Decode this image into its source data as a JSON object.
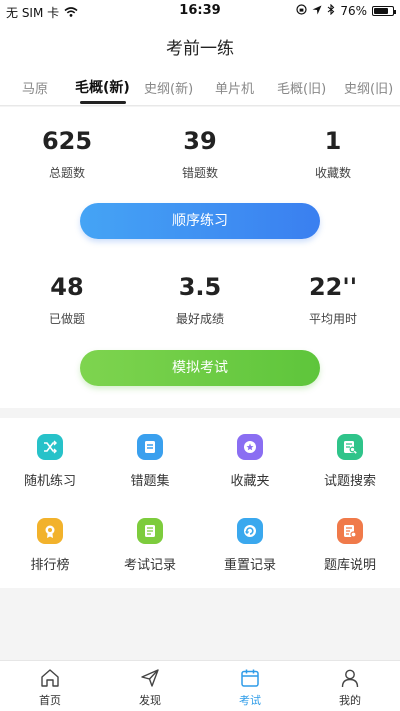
{
  "status_bar": {
    "carrier": "无 SIM 卡",
    "time": "16:39",
    "battery": "76%",
    "battery_level": 0.76
  },
  "nav": {
    "title": "考前一练"
  },
  "tabs": [
    {
      "label": "马原",
      "active": false
    },
    {
      "label": "毛概(新)",
      "active": true
    },
    {
      "label": "史纲(新)",
      "active": false
    },
    {
      "label": "单片机",
      "active": false
    },
    {
      "label": "毛概(旧)",
      "active": false
    },
    {
      "label": "史纲(旧)",
      "active": false
    }
  ],
  "stats_top": [
    {
      "value": "625",
      "label": "总题数"
    },
    {
      "value": "39",
      "label": "错题数"
    },
    {
      "value": "1",
      "label": "收藏数"
    }
  ],
  "practice_button": "顺序练习",
  "stats_bottom": [
    {
      "value": "48",
      "label": "已做题"
    },
    {
      "value": "3.5",
      "label": "最好成绩"
    },
    {
      "value": "22''",
      "label": "平均用时"
    }
  ],
  "exam_button": "模拟考试",
  "features": [
    {
      "label": "随机练习",
      "icon": "shuffle-icon",
      "color": "#27c2c9"
    },
    {
      "label": "错题集",
      "icon": "note-icon",
      "color": "#3aa0ee"
    },
    {
      "label": "收藏夹",
      "icon": "star-icon",
      "color": "#8a6ef2"
    },
    {
      "label": "试题搜索",
      "icon": "search-doc-icon",
      "color": "#2fc48a"
    },
    {
      "label": "排行榜",
      "icon": "trophy-icon",
      "color": "#f2b22c"
    },
    {
      "label": "考试记录",
      "icon": "list-icon",
      "color": "#7dcc3d"
    },
    {
      "label": "重置记录",
      "icon": "reset-icon",
      "color": "#3aa8ee"
    },
    {
      "label": "题库说明",
      "icon": "doc-icon",
      "color": "#f07a4a"
    }
  ],
  "tabbar": [
    {
      "label": "首页",
      "icon": "home-icon",
      "active": false
    },
    {
      "label": "发现",
      "icon": "send-icon",
      "active": false
    },
    {
      "label": "考试",
      "icon": "calendar-icon",
      "active": true
    },
    {
      "label": "我的",
      "icon": "user-icon",
      "active": false
    }
  ],
  "colors": {
    "accent": "#2f9ce8",
    "text": "#222222"
  }
}
